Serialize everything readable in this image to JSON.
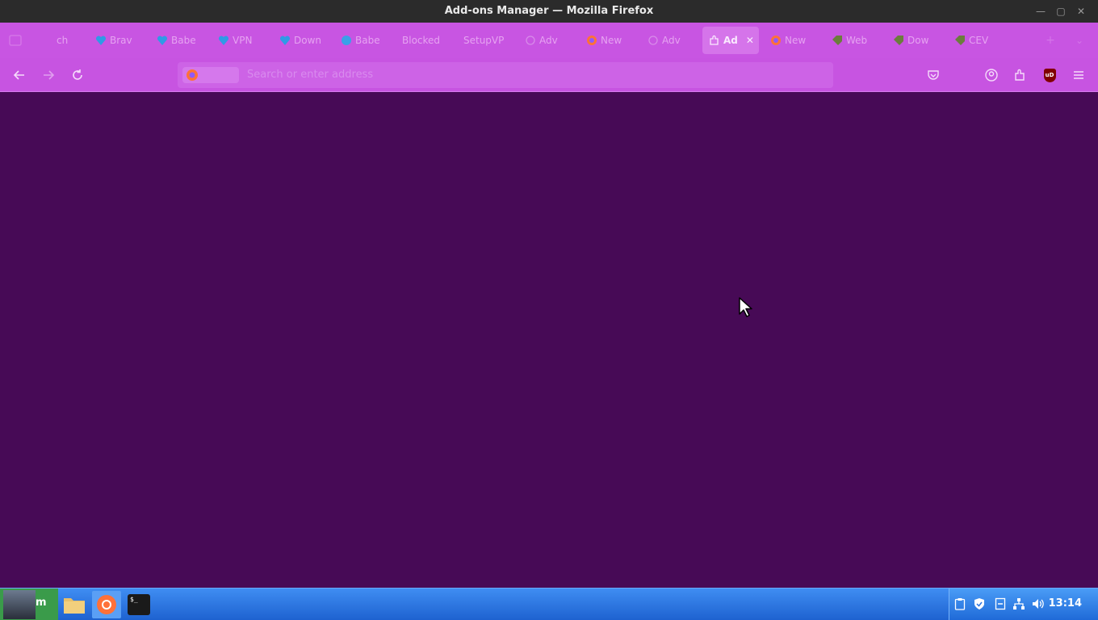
{
  "window": {
    "title": "Add-ons Manager — Mozilla Firefox"
  },
  "tabs": [
    {
      "label": "ch",
      "icon": "generic-page-icon"
    },
    {
      "label": "Brav",
      "icon": "heart-icon"
    },
    {
      "label": "Babe",
      "icon": "heart-icon"
    },
    {
      "label": "VPN",
      "icon": "heart-icon"
    },
    {
      "label": "Down",
      "icon": "heart-icon"
    },
    {
      "label": "Babe",
      "icon": "globe-icon"
    },
    {
      "label": "Blocked",
      "icon": "none"
    },
    {
      "label": "SetupVP",
      "icon": "none"
    },
    {
      "label": "Adv",
      "icon": "generic-page-icon"
    },
    {
      "label": "New",
      "icon": "firefox-icon"
    },
    {
      "label": "Adv",
      "icon": "generic-page-icon"
    },
    {
      "label": "Ad",
      "icon": "puzzle-icon",
      "active": true
    },
    {
      "label": "New",
      "icon": "firefox-icon"
    },
    {
      "label": "Web",
      "icon": "tag-icon"
    },
    {
      "label": "Dow",
      "icon": "tag-icon"
    },
    {
      "label": "CEV",
      "icon": "tag-icon"
    }
  ],
  "toolbar": {
    "back_icon": "arrow-left-icon",
    "forward_icon": "arrow-right-icon",
    "reload_icon": "reload-icon",
    "url_placeholder": "Search or enter address",
    "pocket_icon": "pocket-icon",
    "account_icon": "account-icon",
    "extensions_icon": "puzzle-icon",
    "ublock_label": "uD",
    "menu_icon": "hamburger-menu-icon"
  },
  "taskbar": {
    "start_label": "m",
    "apps": [
      "file-manager-icon",
      "firefox-icon",
      "terminal-icon"
    ],
    "terminal_glyph": "$_",
    "tray": [
      "clipboard-icon",
      "shield-icon",
      "update-icon",
      "network-icon",
      "volume-icon"
    ],
    "clock": "13:14"
  },
  "colors": {
    "content_bg": "#470a56",
    "toolbar_bg": "#c754e1",
    "taskbar_bg": "#2a73e0"
  }
}
